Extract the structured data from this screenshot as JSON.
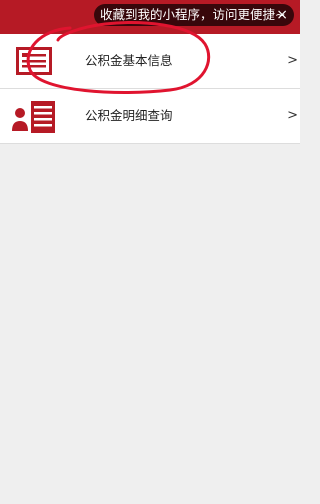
{
  "header": {
    "favorite_tip": "收藏到我的小程序，访问更便捷~",
    "close_glyph": "×",
    "colors": {
      "bar": "#b61a25",
      "tip_bg": "#1c0406"
    }
  },
  "menu": {
    "items": [
      {
        "label": "公积金基本信息",
        "icon": "id-card-icon",
        "chevron": ">"
      },
      {
        "label": "公积金明细查询",
        "icon": "user-list-icon",
        "chevron": ">"
      }
    ]
  },
  "colors": {
    "accent": "#b61a25",
    "page_bg": "#efefef"
  }
}
